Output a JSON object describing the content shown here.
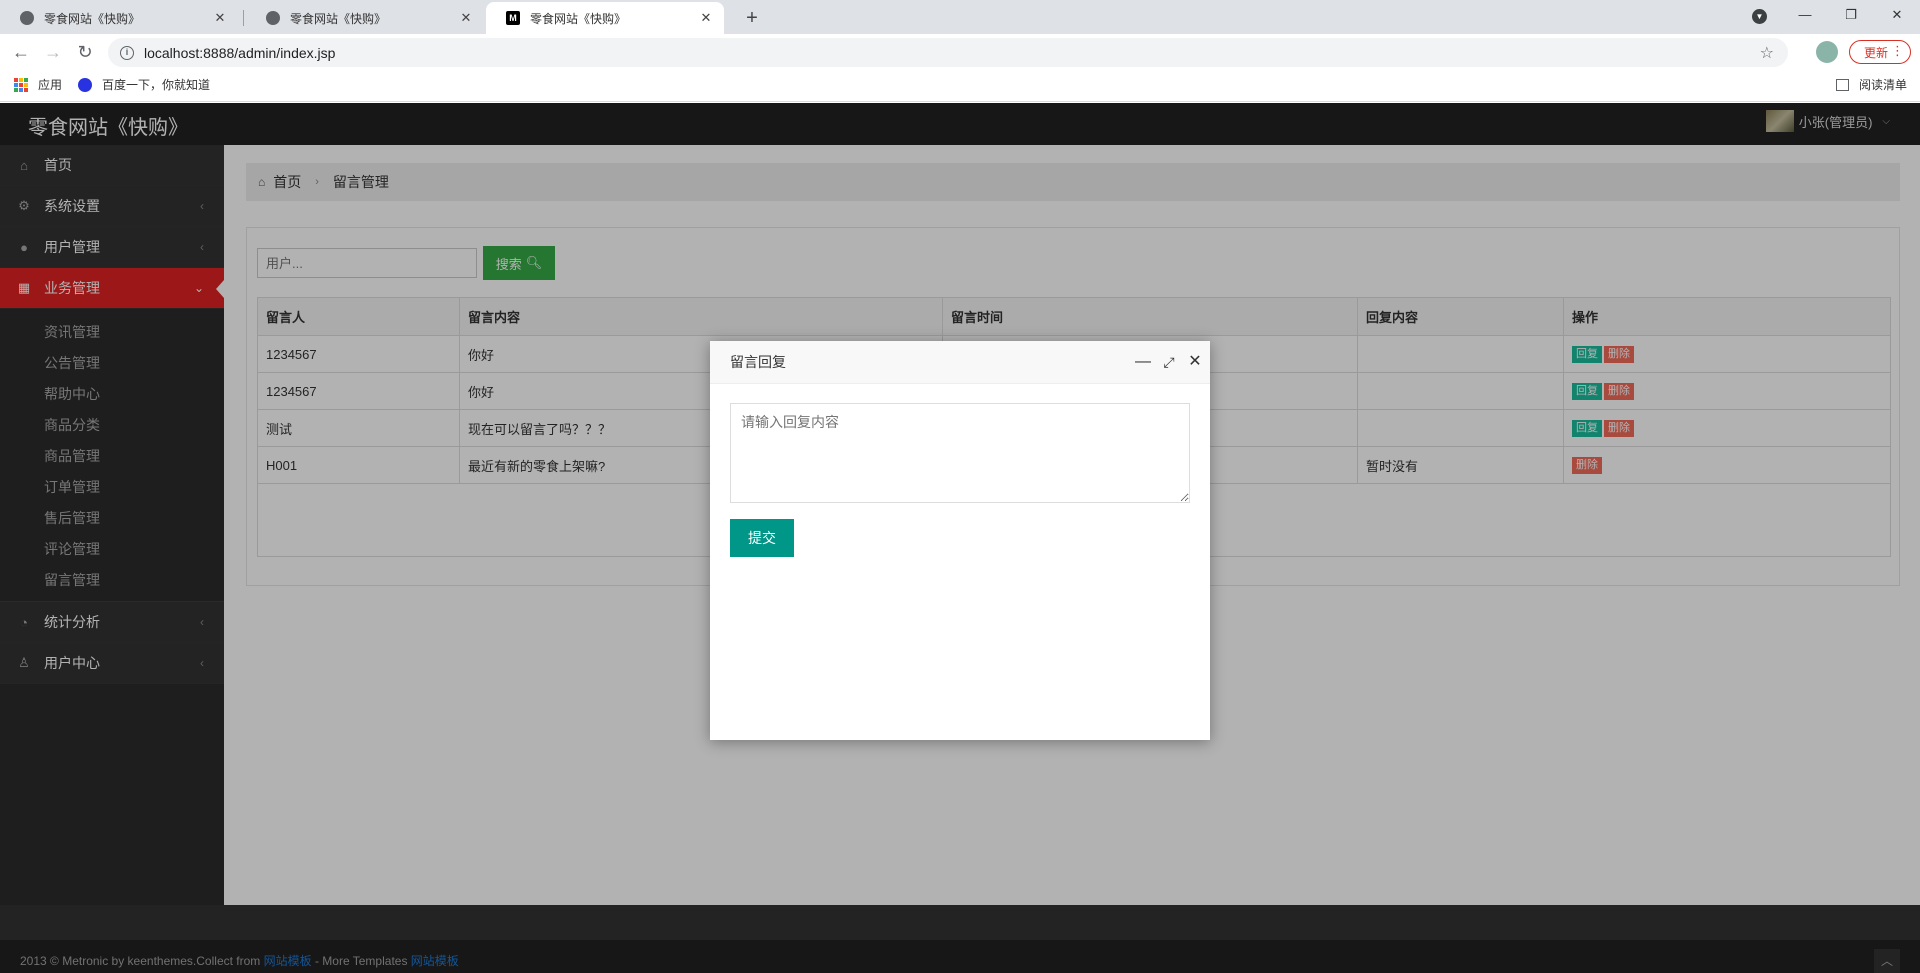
{
  "browser": {
    "tabs": [
      {
        "title": "零食网站《快购》",
        "active": false
      },
      {
        "title": "零食网站《快购》",
        "active": false
      },
      {
        "title": "零食网站《快购》",
        "active": true
      }
    ],
    "new_tab": "+",
    "url": "localhost:8888/admin/index.jsp",
    "update_label": "更新",
    "bookmarks": {
      "apps": "应用",
      "baidu": "百度一下，你就知道",
      "reading_list": "阅读清单"
    }
  },
  "header": {
    "brand": "零食网站《快购》",
    "user": "小张(管理员)"
  },
  "sidebar": {
    "items": [
      {
        "label": "首页",
        "icon": "home-icon"
      },
      {
        "label": "系统设置",
        "icon": "gears-icon"
      },
      {
        "label": "用户管理",
        "icon": "user-icon"
      },
      {
        "label": "业务管理",
        "icon": "grid-icon",
        "active": true
      },
      {
        "label": "统计分析",
        "icon": "dashboard-icon"
      },
      {
        "label": "用户中心",
        "icon": "user-center-icon"
      }
    ],
    "submenu": [
      "资讯管理",
      "公告管理",
      "帮助中心",
      "商品分类",
      "商品管理",
      "订单管理",
      "售后管理",
      "评论管理",
      "留言管理"
    ]
  },
  "breadcrumb": {
    "home": "首页",
    "current": "留言管理"
  },
  "search": {
    "placeholder": "用户...",
    "button": "搜索"
  },
  "table": {
    "headers": [
      "留言人",
      "留言内容",
      "留言时间",
      "回复内容",
      "操作"
    ],
    "rows": [
      {
        "user": "1234567",
        "content": "你好",
        "time": "",
        "reply": "",
        "actions": [
          "回复",
          "删除"
        ]
      },
      {
        "user": "1234567",
        "content": "你好",
        "time": "",
        "reply": "",
        "actions": [
          "回复",
          "删除"
        ]
      },
      {
        "user": "测试",
        "content": "现在可以留言了吗？？？",
        "time": "",
        "reply": "",
        "actions": [
          "回复",
          "删除"
        ]
      },
      {
        "user": "H001",
        "content": "最近有新的零食上架嘛?",
        "time": "",
        "reply": "暂时没有",
        "actions": [
          "删除"
        ]
      }
    ]
  },
  "dialog": {
    "title": "留言回复",
    "placeholder": "请输入回复内容",
    "submit": "提交"
  },
  "footer": {
    "prefix": "2013 © Metronic by keenthemes.Collect from ",
    "link1": "网站模板",
    "middle": " - More Templates ",
    "link2": "网站模板"
  },
  "colors": {
    "accent": "#e02222",
    "search": "#35aa47",
    "submit": "#009688",
    "reply": "#1bbc9b",
    "delete": "#f36a5a"
  }
}
